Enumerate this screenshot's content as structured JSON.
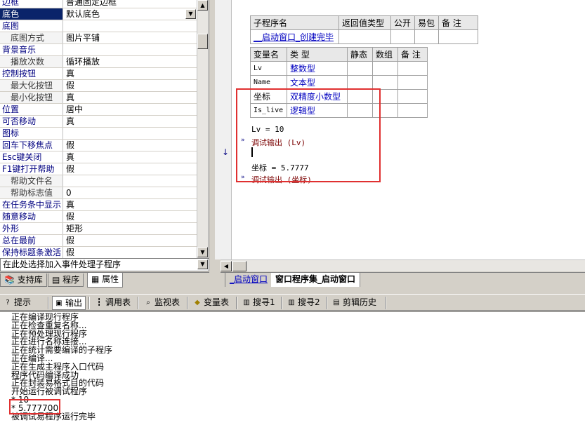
{
  "properties": [
    {
      "name": "边框",
      "value": "普通固定边框",
      "sub": false
    },
    {
      "name": "底色",
      "value": "默认底色",
      "sub": false,
      "selected": true,
      "dropdown": true
    },
    {
      "name": "底图",
      "value": "",
      "sub": false
    },
    {
      "name": "底图方式",
      "value": "图片平铺",
      "sub": true
    },
    {
      "name": "背景音乐",
      "value": "",
      "sub": false
    },
    {
      "name": "播放次数",
      "value": "循环播放",
      "sub": true
    },
    {
      "name": "控制按钮",
      "value": "真",
      "sub": false
    },
    {
      "name": "最大化按钮",
      "value": "假",
      "sub": true
    },
    {
      "name": "最小化按钮",
      "value": "真",
      "sub": true
    },
    {
      "name": "位置",
      "value": "居中",
      "sub": false
    },
    {
      "name": "可否移动",
      "value": "真",
      "sub": false
    },
    {
      "name": "图标",
      "value": "",
      "sub": false
    },
    {
      "name": "回车下移焦点",
      "value": "假",
      "sub": false
    },
    {
      "name": "Esc键关闭",
      "value": "真",
      "sub": false
    },
    {
      "name": "F1键打开帮助",
      "value": "假",
      "sub": false
    },
    {
      "name": "帮助文件名",
      "value": "",
      "sub": true
    },
    {
      "name": "帮助标志值",
      "value": "0",
      "sub": true
    },
    {
      "name": "在任务条中显示",
      "value": "真",
      "sub": false
    },
    {
      "name": "随意移动",
      "value": "假",
      "sub": false
    },
    {
      "name": "外形",
      "value": "矩形",
      "sub": false
    },
    {
      "name": "总在最前",
      "value": "假",
      "sub": false
    },
    {
      "name": "保持标题条激活",
      "value": "假",
      "sub": false
    }
  ],
  "event_combo": {
    "label": "在此处选择加入事件处理子程序"
  },
  "left_tabs": [
    {
      "label": "支持库",
      "icon": "library-icon"
    },
    {
      "label": "程序",
      "icon": "program-icon"
    },
    {
      "label": "属性",
      "icon": "property-icon"
    }
  ],
  "sub_table": {
    "headers": [
      "子程序名",
      "返回值类型",
      "公开",
      "易包",
      "备 注"
    ],
    "row": [
      "__启动窗口_创建完毕",
      "",
      "",
      "",
      ""
    ]
  },
  "var_table": {
    "headers": [
      "变量名",
      "类 型",
      "静态",
      "数组",
      "备 注"
    ],
    "rows": [
      [
        "Lv",
        "整数型",
        "",
        "",
        ""
      ],
      [
        "Name",
        "文本型",
        "",
        "",
        ""
      ],
      [
        "坐标",
        "双精度小数型",
        "",
        "",
        ""
      ],
      [
        "Is_live",
        "逻辑型",
        "",
        "",
        ""
      ]
    ]
  },
  "code_lines": {
    "l1": "Lv = 10",
    "l2": "调试输出 (Lv)",
    "l3": "坐标 = 5.7777",
    "l4": "调试输出 (坐标)"
  },
  "code_tabs": [
    {
      "label": "_启动窗口"
    },
    {
      "label": "窗口程序集_启动窗口"
    }
  ],
  "bottom_tabs": [
    {
      "label": "提示",
      "icon": "hint-icon"
    },
    {
      "label": "输出",
      "icon": "output-icon"
    },
    {
      "label": "调用表",
      "icon": "call-table-icon"
    },
    {
      "label": "监视表",
      "icon": "watch-icon"
    },
    {
      "label": "变量表",
      "icon": "variable-icon"
    },
    {
      "label": "搜寻1",
      "icon": "search1-icon"
    },
    {
      "label": "搜寻2",
      "icon": "search2-icon"
    },
    {
      "label": "剪辑历史",
      "icon": "clip-history-icon"
    }
  ],
  "output_lines": [
    "正在编译现行程序",
    "正在检查重复名称...",
    "正在预处理现行程序",
    "正在进行名称连接...",
    "正在统计需要编译的子程序",
    "正在编译...",
    "正在生成主程序入口代码",
    "程序代码编译成功",
    "正在封装易格式目的代码",
    "开始运行被调试程序",
    "* 10",
    "* 5.777700",
    "被调试易程序运行完毕"
  ],
  "colors": {
    "accent": "#0a246a",
    "highlight_box": "#e03030",
    "link": "#0000c0"
  }
}
